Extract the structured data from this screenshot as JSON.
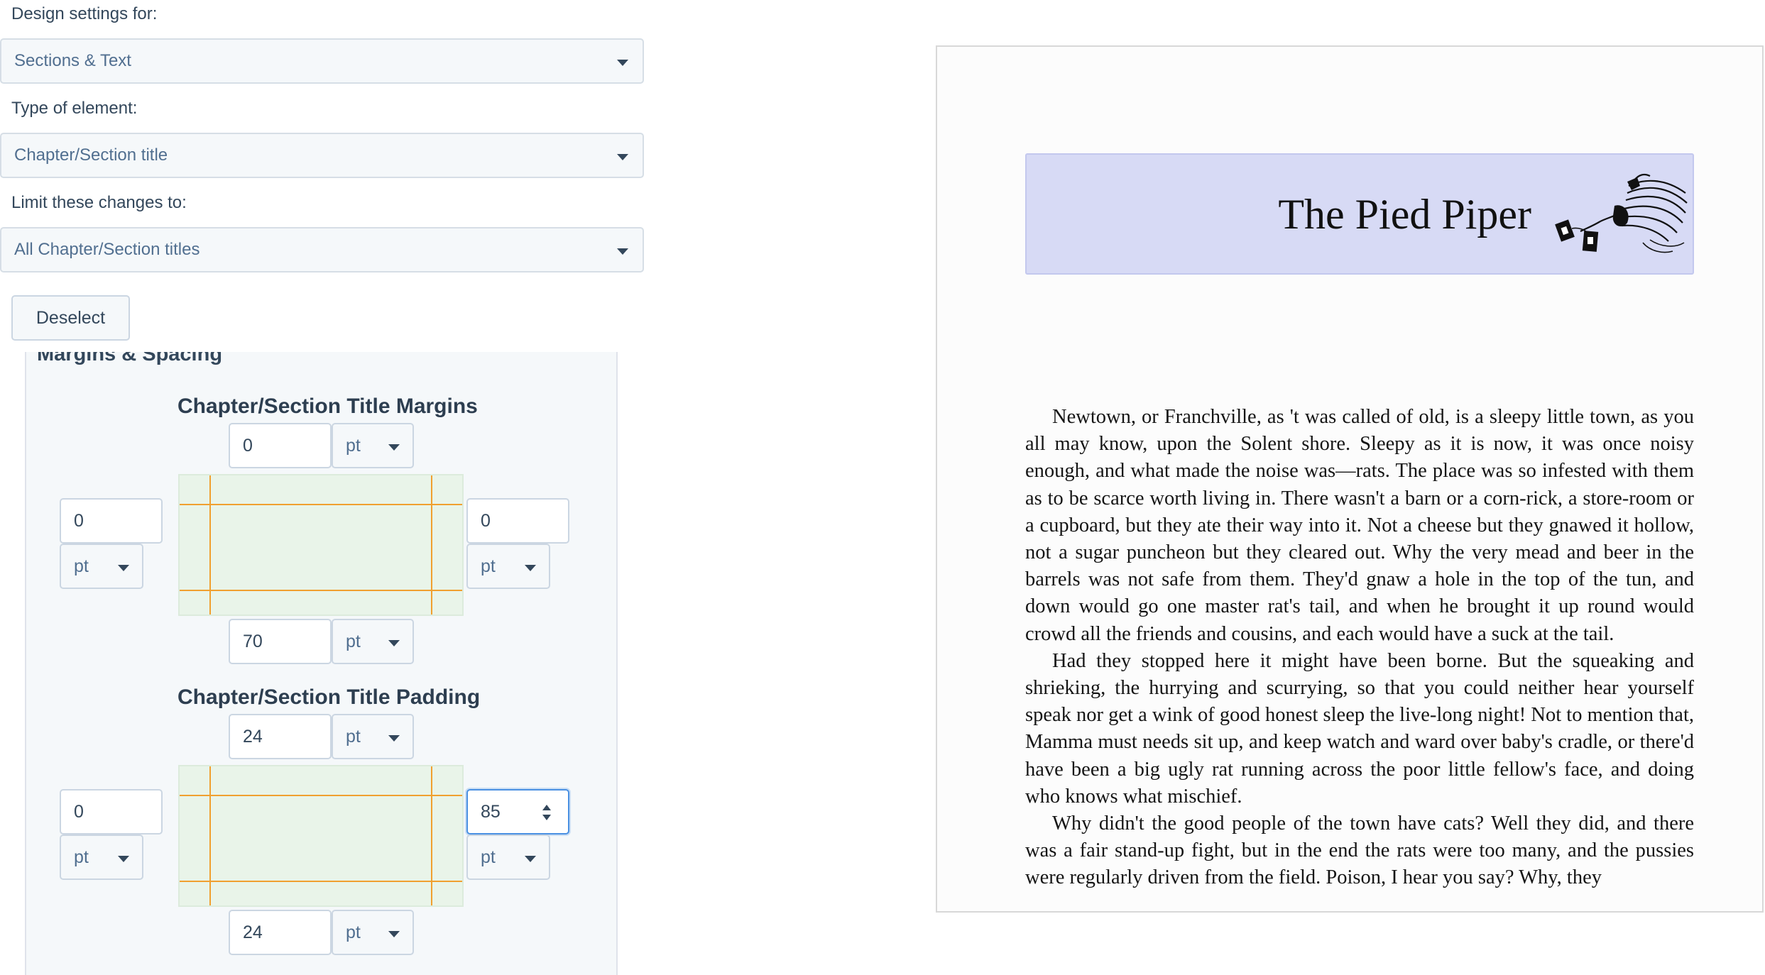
{
  "settings": {
    "design_settings_label": "Design settings for:",
    "design_settings_value": "Sections & Text",
    "element_type_label": "Type of element:",
    "element_type_value": "Chapter/Section title",
    "limit_label": "Limit these changes to:",
    "limit_value": "All Chapter/Section titles",
    "deselect_label": "Deselect"
  },
  "margins_spacing": {
    "section_title": "Margins & Spacing",
    "margins": {
      "title": "Chapter/Section Title Margins",
      "top": "0",
      "top_unit": "pt",
      "left": "0",
      "left_unit": "pt",
      "right": "0",
      "right_unit": "pt",
      "bottom": "70",
      "bottom_unit": "pt"
    },
    "padding": {
      "title": "Chapter/Section Title Padding",
      "top": "24",
      "top_unit": "pt",
      "left": "0",
      "left_unit": "pt",
      "right": "85",
      "right_unit": "pt",
      "bottom": "24",
      "bottom_unit": "pt"
    }
  },
  "preview": {
    "chapter_title": "The Pied Piper",
    "paragraphs": [
      "Newtown, or Franchville, as 't was called of old, is a sleepy little town, as you all may know, upon the Solent shore. Sleepy as it is now, it was once noisy enough, and what made the noise was—rats. The place was so infested with them as to be scarce worth living in. There wasn't a barn or a corn-rick, a store-room or a cupboard, but they ate their way into it. Not a cheese but they gnawed it hollow, not a sugar puncheon but they cleared out. Why the very mead and beer in the barrels was not safe from them. They'd gnaw a hole in the top of the tun, and down would go one master rat's tail, and when he brought it up round would crowd all the friends and cousins, and each would have a suck at the tail.",
      "Had they stopped here it might have been borne. But the squeaking and shrieking, the hurrying and scurrying, so that you could neither hear yourself speak nor get a wink of good honest sleep the live-long night! Not to mention that, Mamma must needs sit up, and keep watch and ward over baby's cradle, or there'd have been a big ugly rat running across the poor little fellow's face, and doing who knows what mischief.",
      "Why didn't the good people of the town have cats? Well they did, and there was a fair stand-up fight, but in the end the rats were too many, and the pussies were regularly driven from the field. Poison, I hear you say? Why, they"
    ]
  },
  "colors": {
    "accent_focus": "#4a90e2",
    "guide_line": "#f0a030",
    "diagram_fill": "#e9f4e9",
    "title_box_fill": "#d7daf5"
  },
  "icons": {
    "dropdown": "caret-down-icon",
    "stepper": "stepper-icon",
    "ornament": "eagle-ornament-icon"
  }
}
